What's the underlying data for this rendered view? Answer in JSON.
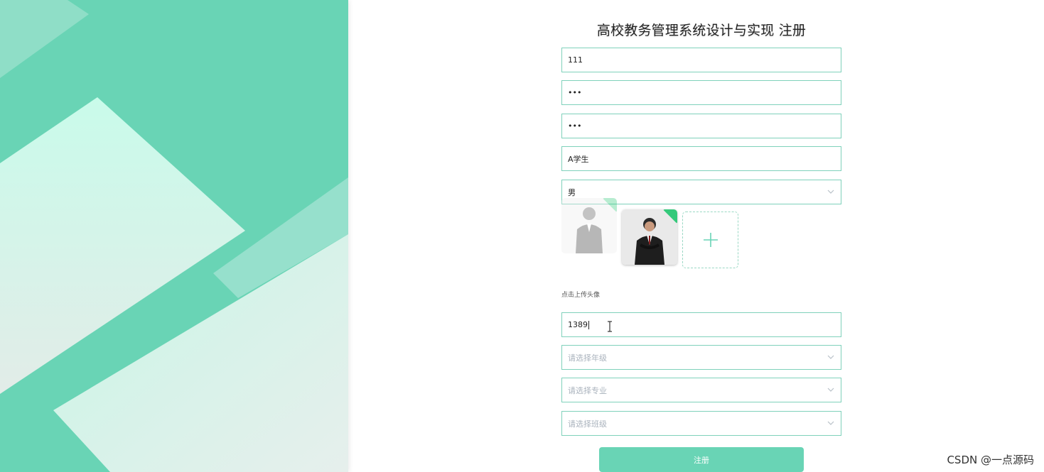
{
  "form": {
    "title": "高校教务管理系统设计与实现 注册",
    "fields": {
      "account": {
        "value": "111"
      },
      "password": {
        "value": "•••"
      },
      "confirm_password": {
        "value": "•••"
      },
      "name": {
        "value": "A学生"
      },
      "gender": {
        "value": "男"
      },
      "phone": {
        "value": "1389"
      },
      "grade": {
        "placeholder": "请选择年级"
      },
      "major": {
        "placeholder": "请选择专业"
      },
      "class": {
        "placeholder": "请选择班级"
      }
    },
    "upload_label": "点击上传头像",
    "submit_label": "注册"
  },
  "watermark": "CSDN @一点源码",
  "colors": {
    "accent": "#69d4b5",
    "field_border": "#7fd1bb",
    "upload_success": "#34c97a"
  }
}
